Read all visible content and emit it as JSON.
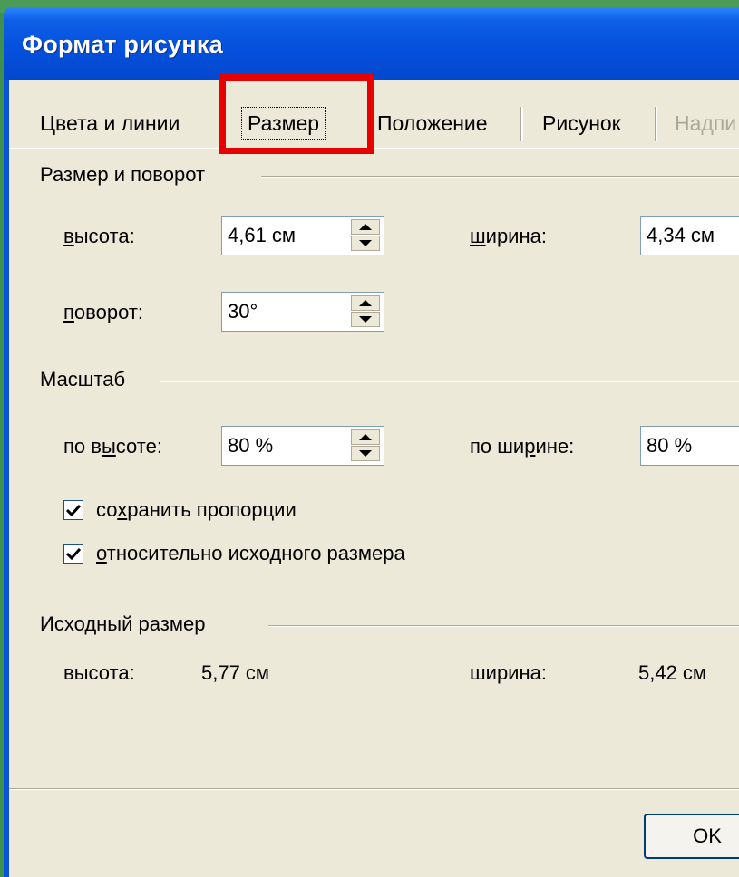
{
  "window": {
    "title": "Формат рисунка"
  },
  "tabs": [
    {
      "label": "Цвета и линии",
      "state": "normal"
    },
    {
      "label": "Размер",
      "state": "active"
    },
    {
      "label": "Положение",
      "state": "normal"
    },
    {
      "label": "Рисунок",
      "state": "normal"
    },
    {
      "label": "Надпи",
      "state": "disabled"
    }
  ],
  "size_rotation": {
    "header": "Размер и поворот",
    "height_label_pre": "",
    "height_label_u": "в",
    "height_label_post": "ысота:",
    "height_value": "4,61 см",
    "width_label_pre": "",
    "width_label_u": "ш",
    "width_label_post": "ирина:",
    "width_value": "4,34 см",
    "rotation_label_pre": "",
    "rotation_label_u": "п",
    "rotation_label_post": "оворот:",
    "rotation_value": "30°"
  },
  "scale": {
    "header": "Масштаб",
    "by_height_label_pre": "по в",
    "by_height_label_u": "ы",
    "by_height_label_post": "соте:",
    "by_height_value": "80 %",
    "by_width_label_pre": "по ши",
    "by_width_label_u": "р",
    "by_width_label_post": "ине:",
    "by_width_value": "80 %",
    "keep_ratio_pre": "со",
    "keep_ratio_u": "х",
    "keep_ratio_post": "ранить пропорции",
    "keep_ratio_checked": true,
    "relative_pre": "",
    "relative_u": "о",
    "relative_post": "тносительно исходного размера",
    "relative_checked": true
  },
  "original": {
    "header": "Исходный размер",
    "height_label": "высота:",
    "height_value": "5,77 см",
    "width_label": "ширина:",
    "width_value": "5,42 см"
  },
  "buttons": {
    "ok": "OK"
  },
  "colors": {
    "highlight": "#e60000",
    "title_bar": "#0551dd",
    "face": "#ece9d8"
  }
}
